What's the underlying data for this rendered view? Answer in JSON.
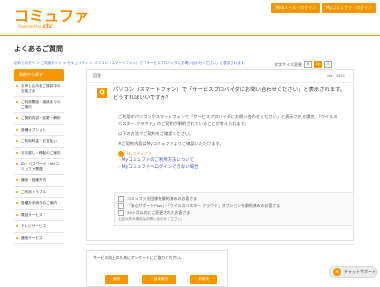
{
  "header": {
    "logo_text": "コミュファ",
    "logo_sub": "Powered by ",
    "logo_brand": "ctc",
    "top_buttons": [
      "Webメール・ログイン",
      "Myコミュファ・ログイン"
    ]
  },
  "page_title": "よくあるご質問",
  "breadcrumb": "初めての方へ ＞ ご利用ガイド ＞ セキュリティ ＞ パソコン（スマートフォン）で「サービスプロバイダにお問い合わせください」と表示されます。",
  "font_size": {
    "label": "文字サイズ変更",
    "options": [
      "大",
      "中",
      "小"
    ]
  },
  "sidebar": {
    "header": "契約から探す",
    "items": [
      "お申し込みをご検討中のお客さま",
      "ご利用開始・接続までのご案内",
      "ご契約内容・変更・解約",
      "各種オプション",
      "ご利用料金・お支払い",
      "お引越し・移転のご案内",
      "ID・パスワード・Myコミュファ関連",
      "通信・回線方式",
      "ご利用トラブル",
      "各種お手続きのご案内",
      "電話サービス",
      "テレビサービス",
      "通信サービス"
    ]
  },
  "main": {
    "top_label": "回答",
    "question_no": "No：3651",
    "q_badge": "Q",
    "question": "パソコン（スマートフォン）で「サービスプロバイダにお問い合わせください」と表示されます。どうすればいいですか？",
    "answer_paragraphs": [
      "ご利用のパソコンやスマートフォンで「サービスプロバイダにお問い合わせください」と表示される場合、「ウイルスバスター クラウド」のご契約が解約されていることが考えられます。",
      "以下の方法でご契約をご確認ください。",
      "※ご契約内容はMyコミュファよりご確認いただけます。"
    ],
    "support_label": "Myコミュファ",
    "links": [
      "Myコミュファのご利用方法について",
      "Myコミュファへログインできない場合"
    ],
    "related": [
      "コミュファ光回線を解約済みのお客さま",
      "「安心サポートPlus」・「ウイルスバスター クラウド」オプションを解約済みのお客さま",
      "30ヶ月以内にご変更されたお客さま"
    ],
    "related_footer": "上記以外の場合はお問い合わせください。"
  },
  "survey": {
    "text": "サービス向上のためにアンケートにご協力ください。",
    "buttons": [
      "解決",
      "一部未解決",
      "未解決"
    ]
  },
  "chat_label": "チャットサポート"
}
